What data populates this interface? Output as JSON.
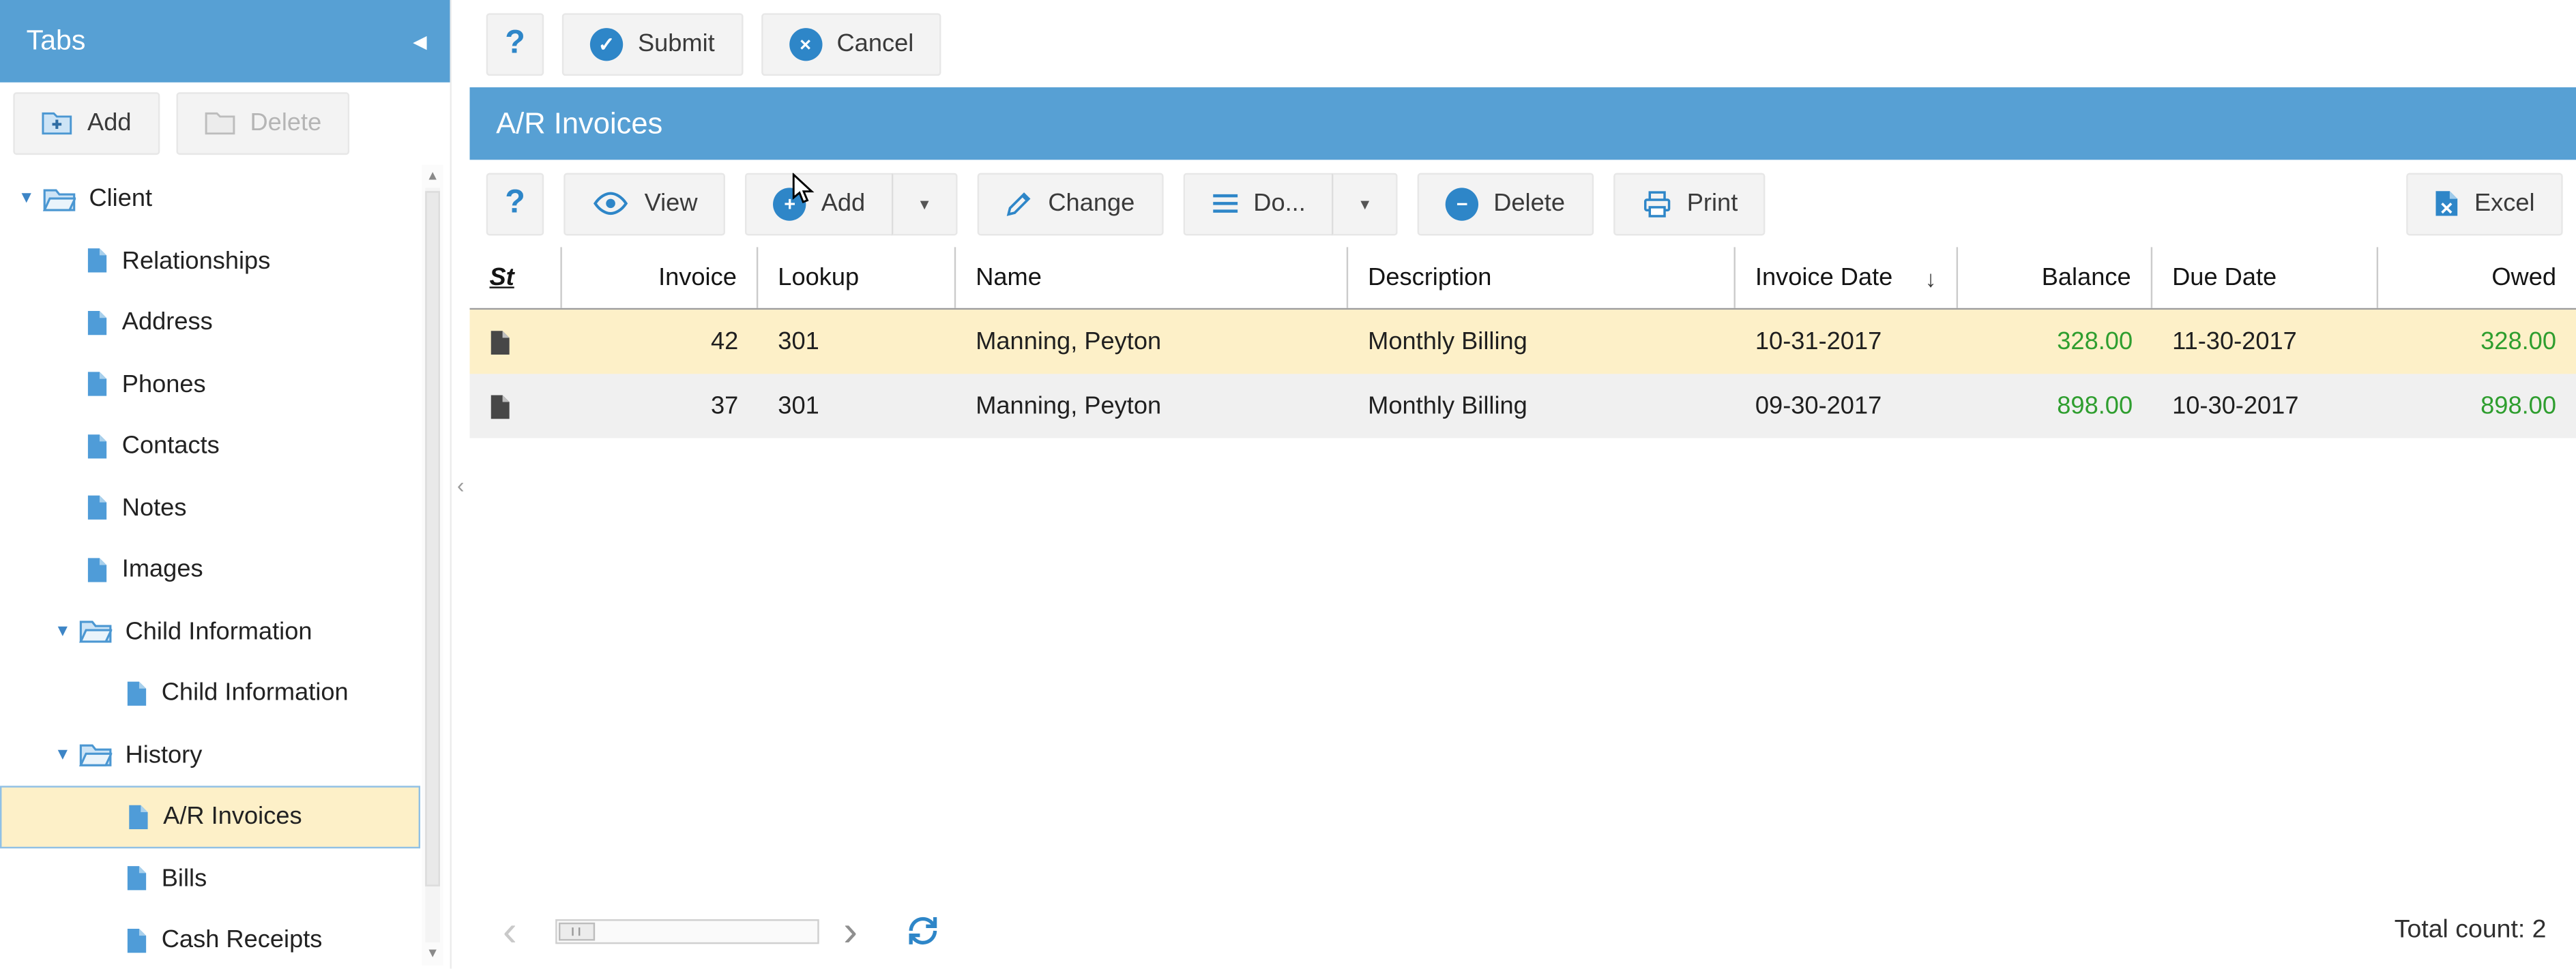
{
  "sidebar": {
    "title": "Tabs",
    "buttons": {
      "add": "Add",
      "delete": "Delete"
    },
    "tree": [
      {
        "label": "Client",
        "type": "folder",
        "level": 0,
        "expanded": true,
        "selected": false
      },
      {
        "label": "Relationships",
        "type": "page",
        "level": 1,
        "selected": false
      },
      {
        "label": "Address",
        "type": "page",
        "level": 1,
        "selected": false
      },
      {
        "label": "Phones",
        "type": "page",
        "level": 1,
        "selected": false
      },
      {
        "label": "Contacts",
        "type": "page",
        "level": 1,
        "selected": false
      },
      {
        "label": "Notes",
        "type": "page",
        "level": 1,
        "selected": false
      },
      {
        "label": "Images",
        "type": "page",
        "level": 1,
        "selected": false
      },
      {
        "label": "Child Information",
        "type": "folder",
        "level": 1,
        "expanded": true,
        "selected": false
      },
      {
        "label": "Child Information",
        "type": "page",
        "level": 2,
        "selected": false
      },
      {
        "label": "History",
        "type": "folder",
        "level": 1,
        "expanded": true,
        "selected": false
      },
      {
        "label": "A/R Invoices",
        "type": "page",
        "level": 2,
        "selected": true
      },
      {
        "label": "Bills",
        "type": "page",
        "level": 2,
        "selected": false
      },
      {
        "label": "Cash Receipts",
        "type": "page",
        "level": 2,
        "selected": false
      }
    ]
  },
  "form_toolbar": {
    "submit": "Submit",
    "cancel": "Cancel"
  },
  "panel": {
    "title": "A/R Invoices"
  },
  "grid_toolbar": {
    "view": "View",
    "add": "Add",
    "change": "Change",
    "do": "Do...",
    "delete": "Delete",
    "print": "Print",
    "excel": "Excel"
  },
  "table": {
    "columns": [
      "St",
      "Invoice",
      "Lookup",
      "Name",
      "Description",
      "Invoice Date",
      "Balance",
      "Due Date",
      "Owed"
    ],
    "sorted_by": "Invoice Date",
    "sort_direction": "desc",
    "rows": [
      {
        "invoice": "42",
        "lookup": "301",
        "name": "Manning, Peyton",
        "description": "Monthly Billing",
        "invoice_date": "10-31-2017",
        "balance": "328.00",
        "due_date": "11-30-2017",
        "owed": "328.00",
        "selected": true
      },
      {
        "invoice": "37",
        "lookup": "301",
        "name": "Manning, Peyton",
        "description": "Monthly Billing",
        "invoice_date": "09-30-2017",
        "balance": "898.00",
        "due_date": "10-30-2017",
        "owed": "898.00",
        "selected": false
      }
    ]
  },
  "footer": {
    "total_count": "Total count: 2"
  },
  "icons": {
    "help": "?",
    "collapse_sidebar": "◀",
    "expanded": "▼",
    "dropdown": "▼",
    "sort_desc": "↓",
    "check": "✓",
    "close": "×",
    "plus": "+",
    "minus": "−",
    "pager_prev": "‹",
    "pager_next": "›",
    "scroll_up": "▲",
    "scroll_down": "▼",
    "splitter_collapse": "‹"
  },
  "colors": {
    "header_blue": "#57a0d4",
    "icon_blue": "#2e86c8",
    "selection_yellow": "#fdf0c8",
    "row_alt_gray": "#f0f0f0",
    "amount_green": "#2f9e2f"
  }
}
